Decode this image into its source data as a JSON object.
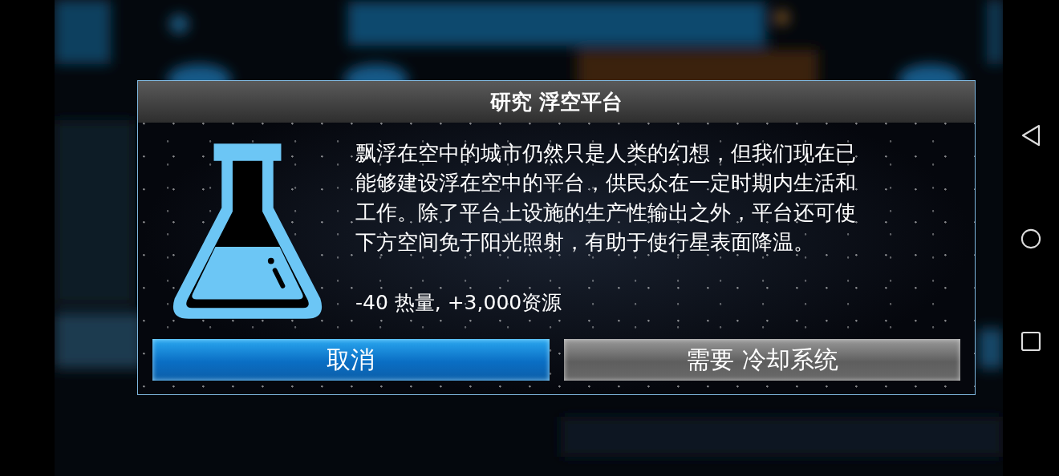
{
  "dialog": {
    "title": "研究 浮空平台",
    "description_lines": [
      "飘浮在空中的城市仍然只是人类的幻想，但我们现在已",
      "能够建设浮在空中的平台，供民众在一定时期内生活和",
      "工作。除了平台上设施的生产性输出之外，平台还可使",
      "下方空间免于阳光照射，有助于使行星表面降温。"
    ],
    "effects": "-40 热量, +3,000资源",
    "buttons": [
      {
        "label": "取消",
        "kind": "primary"
      },
      {
        "label": "需要 冷却系统",
        "kind": "locked"
      }
    ]
  }
}
